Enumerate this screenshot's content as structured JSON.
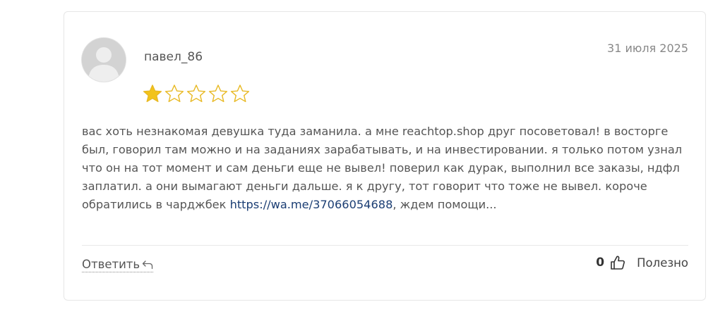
{
  "review": {
    "author": "павел_86",
    "date": "31 июля 2025",
    "rating": 1,
    "rating_max": 5,
    "text_before_link": "вас хоть незнакомая девушка туда заманила. а мне reachtop.shop друг посоветовал! в восторге был, говорил там можно и на заданиях зарабатывать, и на инвестировании. я только потом узнал что он на тот момент и сам деньги еще не вывел! поверил как дурак, выполнил все заказы, ндфл заплатил. а они вымагают деньги дальше. я к другу, тот говорит что тоже не вывел. короче обратились в чарджбек ",
    "link_text": "https://wa.me/37066054688",
    "text_after_link": ", ждем помощи..."
  },
  "actions": {
    "reply_label": "Ответить",
    "like_count": "0",
    "helpful_label": "Полезно"
  },
  "colors": {
    "star_filled": "#f2c31a",
    "star_outline": "#e8b923",
    "link": "#1a3d73",
    "divider": "#e8e8e8"
  },
  "icons": {
    "avatar": "user-avatar-placeholder",
    "reply": "reply-arrow-icon",
    "like": "thumbs-up-icon"
  }
}
